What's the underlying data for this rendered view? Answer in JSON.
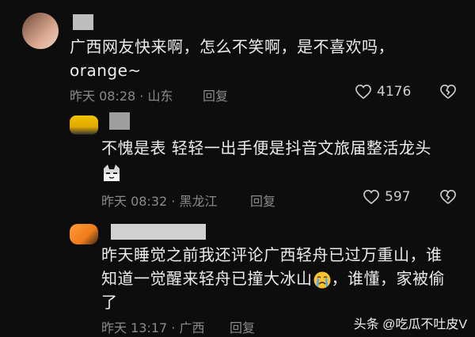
{
  "comments": [
    {
      "text": "广西网友快来啊，怎么不笑啊，是不喜欢吗，orange~",
      "meta": "昨天 08:28 · 山东",
      "reply": "回复",
      "likes": "4176"
    },
    {
      "text": "不愧是表 轻轻一出手便是抖音文旅届整活龙头",
      "meta": "昨天 08:32 · 黑龙江",
      "reply": "回复",
      "likes": "597"
    },
    {
      "text": "昨天睡觉之前我还评论广西轻舟已过万重山，谁知道一觉醒来轻舟已撞大冰山",
      "text_tail": "，谁懂，家被偷了",
      "meta": "昨天 13:17 · 广西",
      "reply": "回复"
    }
  ],
  "watermark": "头条 @吃瓜不吐皮V",
  "colors": {
    "background": "#0d0d0d",
    "text": "#ececec",
    "meta": "#8a8a8a"
  },
  "icons": [
    "heart-icon",
    "broken-heart-icon",
    "sneaky-cat-emoji",
    "crying-emoji"
  ]
}
